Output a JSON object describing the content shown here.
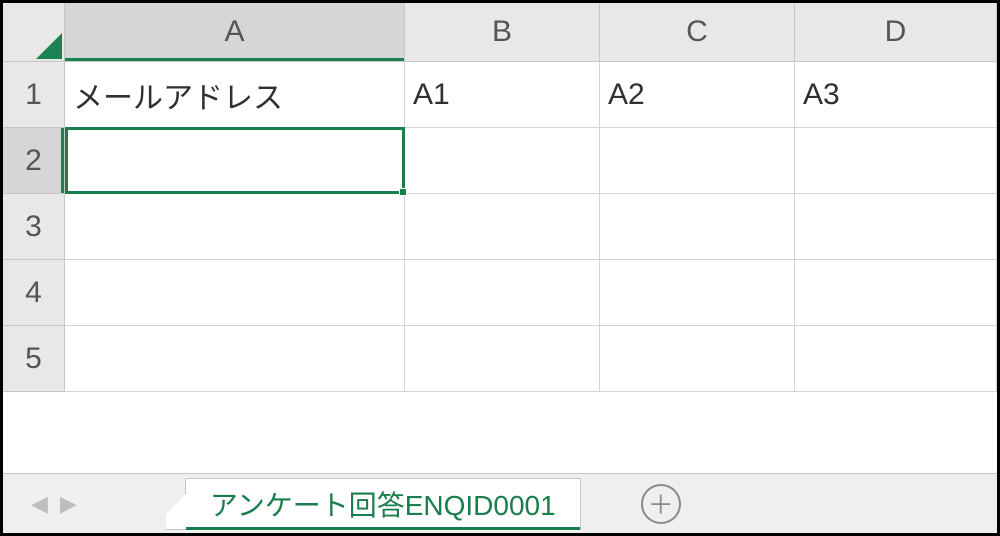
{
  "columns": [
    {
      "letter": "A",
      "class": "col-A",
      "selected": true
    },
    {
      "letter": "B",
      "class": "col-B",
      "selected": false
    },
    {
      "letter": "C",
      "class": "col-C",
      "selected": false
    },
    {
      "letter": "D",
      "class": "col-D",
      "selected": false
    }
  ],
  "rows": [
    {
      "num": "1",
      "selected": false,
      "cells": [
        "メールアドレス",
        "A1",
        "A2",
        "A3"
      ]
    },
    {
      "num": "2",
      "selected": true,
      "cells": [
        "",
        "",
        "",
        ""
      ]
    },
    {
      "num": "3",
      "selected": false,
      "cells": [
        "",
        "",
        "",
        ""
      ]
    },
    {
      "num": "4",
      "selected": false,
      "cells": [
        "",
        "",
        "",
        ""
      ]
    },
    {
      "num": "5",
      "selected": false,
      "cells": [
        "",
        "",
        "",
        ""
      ]
    }
  ],
  "active_cell": "A2",
  "sheet_tab": "アンケート回答ENQID0001",
  "add_symbol": "＋",
  "nav_prev": "◀",
  "nav_next": "▶"
}
